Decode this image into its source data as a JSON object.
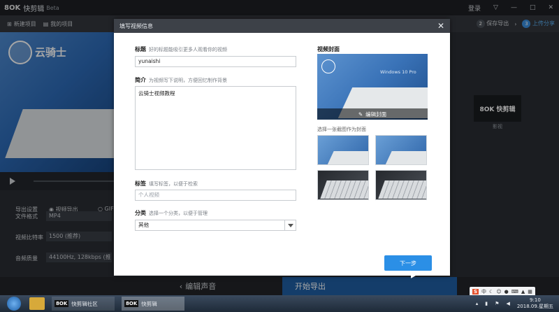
{
  "app": {
    "logo": "8OK",
    "name": "快剪辑",
    "badge": "Beta",
    "login": "登录"
  },
  "menubar": {
    "new_project": "新建项目",
    "my_projects": "我的项目",
    "steps": [
      {
        "num": "2",
        "label": "保存导出",
        "active": false
      },
      {
        "num": "3",
        "label": "上传分享",
        "active": true
      }
    ]
  },
  "preview": {
    "watermark": "云骑士",
    "export_settings_label": "导出设置",
    "export_video_option": "视频导出",
    "gif_option": "GIF",
    "file_format_label": "文件格式",
    "file_format_value": "MP4",
    "bitrate_label": "视频比特率",
    "bitrate_value": "1500 (推荐)",
    "audio_quality_label": "音频质量",
    "audio_quality_value": "44100Hz, 128kbps (推"
  },
  "right_panel": {
    "brand_text": "8OK 快剪辑",
    "caption": "影视"
  },
  "bottombar": {
    "edit_audio": "编辑声音",
    "start_export": "开始导出"
  },
  "dialog": {
    "title": "填写视频信息",
    "title_label": "标题",
    "title_hint": "好的标题能吸引更多人观看你的视频",
    "title_value": "yunaishi",
    "intro_label": "简介",
    "intro_hint": "为视频写下说明，方便回忆制作背景",
    "intro_value": "云骑士视频教程",
    "tags_label": "标签",
    "tags_hint": "填写标签，以便于检索",
    "tags_placeholder": "个人视频",
    "category_label": "分类",
    "category_hint": "选择一个分类，以便于管理",
    "category_value": "其他",
    "cover_title": "视频封面",
    "cover_screen_text": "Windows 10 Pro",
    "edit_cover": "编辑封面",
    "choose_cover_hint": "选择一张截图作为封面",
    "next_button": "下一步"
  },
  "taskbar": {
    "tasks": [
      {
        "logo": "8OK",
        "label": "快剪辑社区",
        "active": false
      },
      {
        "logo": "8OK",
        "label": "快剪辑",
        "active": true
      }
    ],
    "ime_logo": "S",
    "ime_lang": "中",
    "time": "9:10",
    "date": "2018.09.星期五"
  }
}
